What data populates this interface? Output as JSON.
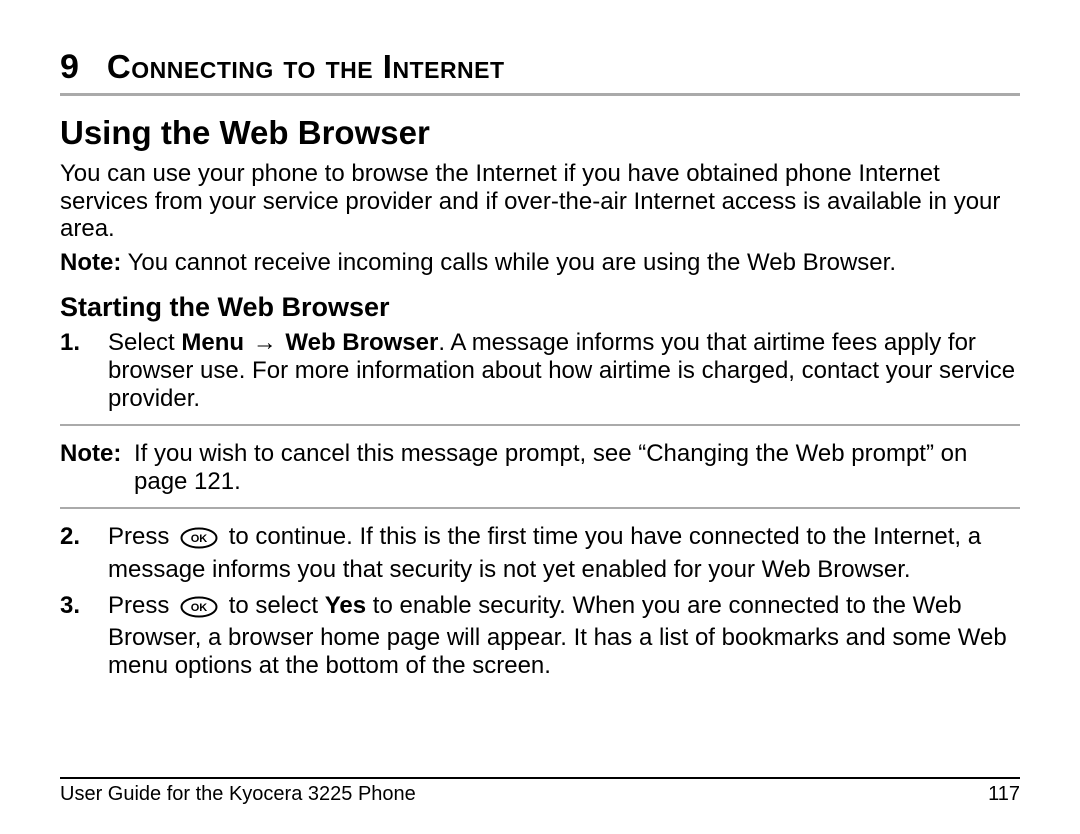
{
  "chapter": {
    "number": "9",
    "title": "Connecting to the Internet"
  },
  "section": {
    "heading": "Using the Web Browser"
  },
  "intro": "You can use your phone to browse the Internet if you have obtained phone Internet services from your service provider and if over-the-air Internet access is available in your area.",
  "introNote": {
    "label": "Note:",
    "text": " You cannot receive incoming calls while you are using the Web Browser."
  },
  "subsection": {
    "heading": "Starting the Web Browser"
  },
  "step1": {
    "marker": "1.",
    "lead": "Select ",
    "menu": "Menu",
    "arrow": " → ",
    "target": "Web Browser",
    "tail": ". A message informs you that airtime fees apply for browser use. For more information about how airtime is charged, contact your service provider."
  },
  "midNote": {
    "label": "Note:",
    "text": "If you wish to cancel this message prompt, see “Changing the Web prompt” on page 121."
  },
  "step2": {
    "marker": "2.",
    "pre": "Press ",
    "post": " to continue. If this is the first time you have connected to the Internet, a message informs you that security is not yet enabled for your Web Browser."
  },
  "step3": {
    "marker": "3.",
    "pre": "Press ",
    "mid1": " to select ",
    "yes": "Yes",
    "mid2": " to enable security. When you are connected to the Web Browser, a browser home page will appear. It has a list of bookmarks and some Web menu options at the bottom of the screen."
  },
  "footer": {
    "left": "User Guide for the Kyocera 3225 Phone",
    "right": "117"
  }
}
